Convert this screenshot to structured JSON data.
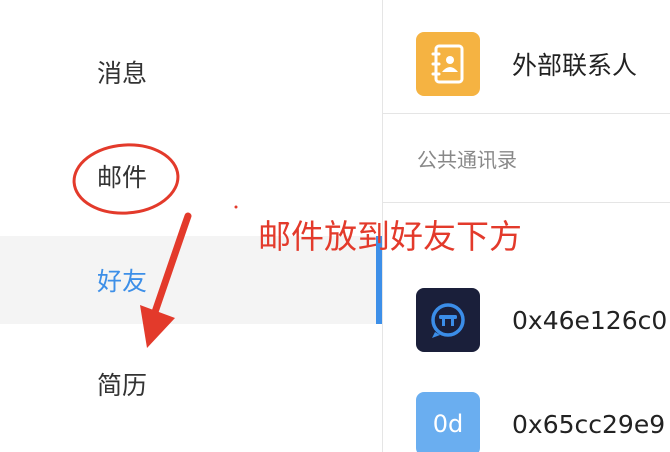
{
  "sidebar": {
    "items": [
      {
        "label": "消息"
      },
      {
        "label": "邮件"
      },
      {
        "label": "好友"
      },
      {
        "label": "简历"
      }
    ],
    "active_index": 2
  },
  "main": {
    "external_contacts": {
      "label": "外部联系人",
      "icon": "contact-book-icon",
      "icon_color": "#f5b342"
    },
    "section_label": "公共通讯录",
    "contacts": [
      {
        "name": "0x46e126c0",
        "avatar": "robot-chat-icon",
        "avatar_color": "#1a1f3a"
      },
      {
        "name": "0x65cc29e9",
        "avatar_text": "0d",
        "avatar_color": "#6aaef0"
      }
    ]
  },
  "annotation": {
    "text": "邮件放到好友下方",
    "color": "#e33a2b"
  },
  "colors": {
    "accent": "#3d8fe8",
    "annotation": "#e33a2b"
  }
}
